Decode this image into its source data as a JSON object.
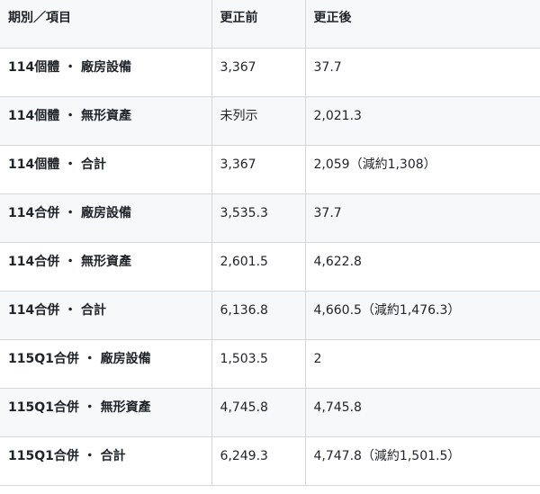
{
  "table": {
    "headers": [
      "期別／項目",
      "更正前",
      "更正後"
    ],
    "rows": [
      [
        "114個體 ・ 廠房設備",
        "3,367",
        "37.7"
      ],
      [
        "114個體 ・ 無形資產",
        "未列示",
        "2,021.3"
      ],
      [
        "114個體 ・ 合計",
        "3,367",
        "2,059（減約1,308）"
      ],
      [
        "114合併 ・ 廠房設備",
        "3,535.3",
        "37.7"
      ],
      [
        "114合併 ・ 無形資產",
        "2,601.5",
        "4,622.8"
      ],
      [
        "114合併 ・ 合計",
        "6,136.8",
        "4,660.5（減約1,476.3）"
      ],
      [
        "115Q1合併 ・ 廠房設備",
        "1,503.5",
        "2"
      ],
      [
        "115Q1合併 ・ 無形資產",
        "4,745.8",
        "4,745.8"
      ],
      [
        "115Q1合併 ・ 合計",
        "6,249.3",
        "4,747.8（減約1,501.5）"
      ]
    ]
  }
}
